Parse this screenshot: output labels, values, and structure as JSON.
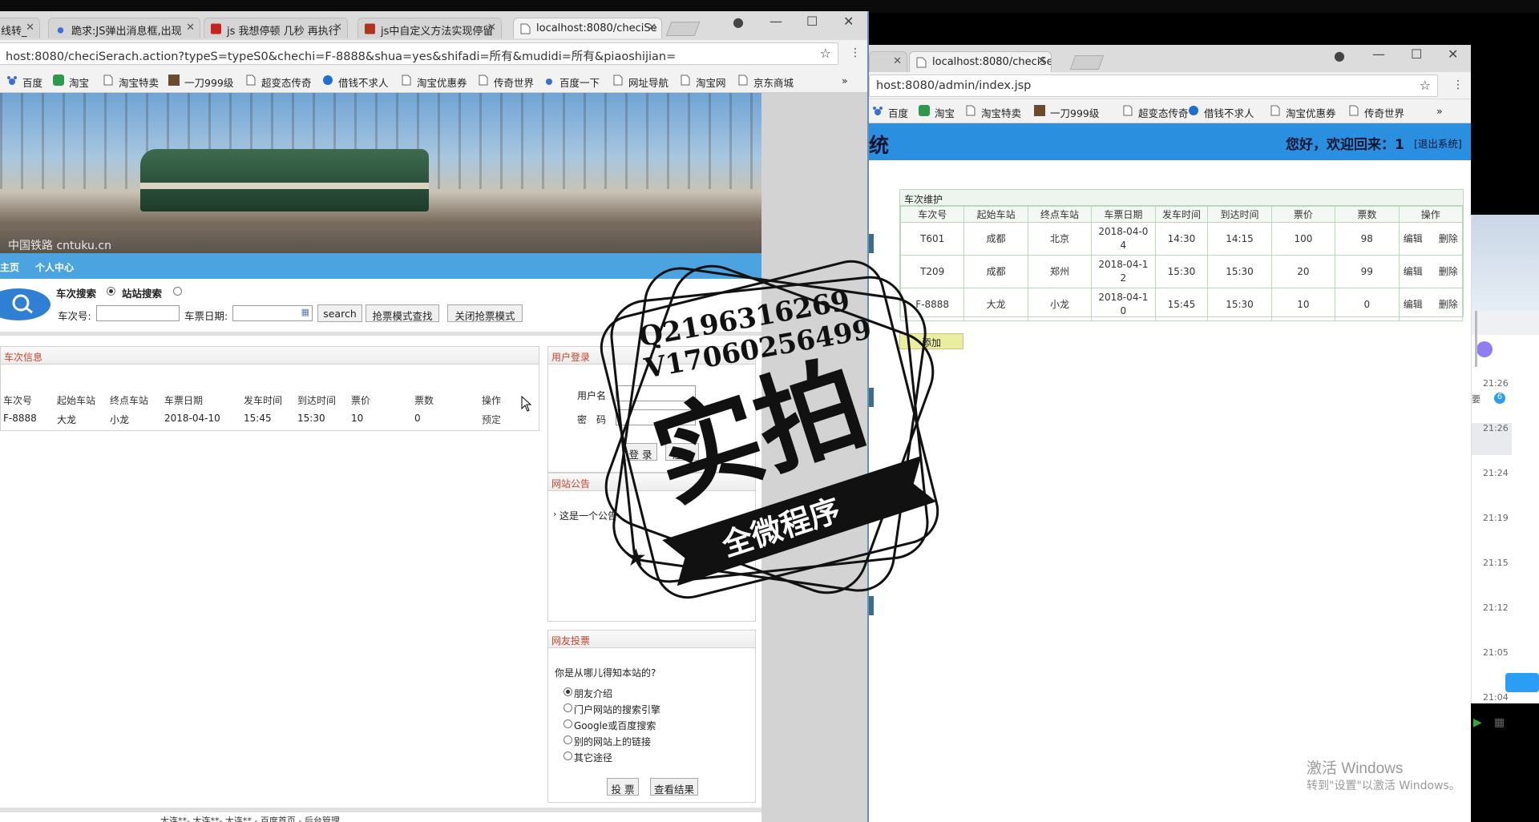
{
  "right_window": {
    "tabs": [
      {
        "label": "",
        "active": false
      },
      {
        "label": "localhost:8080/checiSe",
        "active": true
      }
    ],
    "address": "host:8080/admin/index.jsp",
    "bookmarks": [
      "百度",
      "淘宝",
      "淘宝特卖",
      "一刀999级",
      "超变态传奇",
      "借钱不求人",
      "淘宝优惠券",
      "传奇世界"
    ],
    "header": {
      "system_title": "统",
      "greeting": "您好，欢迎回来：1",
      "logout": "[退出系统]"
    },
    "panel_title": "车次维护",
    "columns": [
      "车次号",
      "起始车站",
      "终点车站",
      "车票日期",
      "发车时间",
      "到达时间",
      "票价",
      "票数",
      "操作"
    ],
    "rows": [
      {
        "num": "T601",
        "from": "成都",
        "to": "北京",
        "date1": "2018-04-0",
        "date2": "4",
        "dep": "14:30",
        "arr": "14:15",
        "price": "100",
        "count": "98",
        "edit": "编辑",
        "del": "删除"
      },
      {
        "num": "T209",
        "from": "成都",
        "to": "郑州",
        "date1": "2018-04-1",
        "date2": "2",
        "dep": "15:30",
        "arr": "15:30",
        "price": "20",
        "count": "99",
        "edit": "编辑",
        "del": "删除"
      },
      {
        "num": "F-8888",
        "from": "大龙",
        "to": "小龙",
        "date1": "2018-04-1",
        "date2": "0",
        "dep": "15:45",
        "arr": "15:30",
        "price": "10",
        "count": "0",
        "edit": "编辑",
        "del": "删除"
      }
    ],
    "add_button": "添加"
  },
  "chat_sidebar": {
    "times": [
      "21:26",
      "21:26",
      "21:24",
      "21:19",
      "21:15",
      "21:12",
      "21:05",
      "21:04"
    ],
    "snippet": "要",
    "badge": "6"
  },
  "activation": {
    "line1": "激活 Windows",
    "line2": "转到\"设置\"以激活 Windows。"
  },
  "left_window": {
    "tabs": [
      {
        "label": "线转_"
      },
      {
        "label": "跪求:JS弹出消息框,出现"
      },
      {
        "label": "js 我想停顿 几秒 再执行"
      },
      {
        "label": "js中自定义方法实现停留"
      },
      {
        "label": "localhost:8080/checiSe"
      }
    ],
    "address": "host:8080/checiSerach.action?typeS=typeS0&chechi=F-8888&shua=yes&shifadi=所有&mudidi=所有&piaoshijian=",
    "bookmarks": [
      "百度",
      "淘宝",
      "淘宝特卖",
      "一刀999级",
      "超变态传奇",
      "借钱不求人",
      "淘宝优惠券",
      "传奇世界",
      "百度一下",
      "网址导航",
      "淘宝网",
      "京东商城"
    ],
    "banner_caption": "中国铁路 cntuku.cn",
    "nav": [
      "主页",
      "个人中心"
    ],
    "search": {
      "mode_train": "车次搜索",
      "mode_station": "站站搜索",
      "train_label": "车次号:",
      "date_label": "车票日期:",
      "search_btn": "search",
      "grab_btn": "抢票模式查找",
      "close_grab_btn": "关闭抢票模式"
    },
    "info_panel": {
      "title": "车次信息",
      "columns": [
        "车次号",
        "起始车站",
        "终点车站",
        "车票日期",
        "发车时间",
        "到达时间",
        "票价",
        "票数",
        "操作"
      ],
      "row": [
        "F-8888",
        "大龙",
        "小龙",
        "2018-04-10",
        "15:45",
        "15:30",
        "10",
        "0",
        "预定"
      ]
    },
    "login_panel": {
      "title": "用户登录",
      "user_label": "用户名",
      "pass_label": "密　码",
      "login_btn": "登 录",
      "register_btn": "注册"
    },
    "notice_panel": {
      "title": "网站公告",
      "item": "这是一个公告"
    },
    "vote_panel": {
      "title": "网友投票",
      "question": "你是从哪儿得知本站的?",
      "options": [
        "朋友介绍",
        "门户网站的搜索引擎",
        "Google或百度搜索",
        "别的网站上的链接",
        "其它途径"
      ],
      "selected": 0,
      "vote_btn": "投 票",
      "result_btn": "查看结果"
    },
    "footer": "大连**- 大连**- 大连** - 百度首页 - 后台管理"
  },
  "watermark": {
    "line1": "Q2196316269",
    "line2": "V17060256499",
    "big": "实拍",
    "ribbon": "全微程序"
  }
}
